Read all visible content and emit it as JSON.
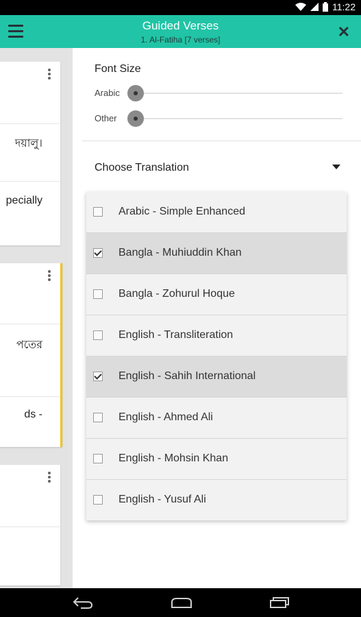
{
  "status_bar": {
    "time": "11:22",
    "icons": [
      "wifi-icon",
      "signal-icon",
      "battery-icon"
    ]
  },
  "app_bar": {
    "title": "Guided Verses",
    "subtitle": "1. Al-Fatiha [7 verses]",
    "accent": "#21c4a6"
  },
  "left_cards": [
    {
      "lines": [
        "দয়ালু।",
        "pecially"
      ]
    },
    {
      "lines": [
        "পতের",
        "ds -"
      ]
    },
    {
      "lines": []
    }
  ],
  "font_size": {
    "title": "Font Size",
    "arabic_label": "Arabic",
    "other_label": "Other"
  },
  "translation": {
    "label": "Choose Translation",
    "options": [
      {
        "label": "Arabic - Simple Enhanced",
        "checked": false
      },
      {
        "label": "Bangla - Muhiuddin Khan",
        "checked": true
      },
      {
        "label": "Bangla - Zohurul Hoque",
        "checked": false
      },
      {
        "label": "English - Transliteration",
        "checked": false
      },
      {
        "label": "English - Sahih International",
        "checked": true
      },
      {
        "label": "English - Ahmed Ali",
        "checked": false
      },
      {
        "label": "English - Mohsin Khan",
        "checked": false
      },
      {
        "label": "English - Yusuf Ali",
        "checked": false
      }
    ]
  },
  "nav_bar": {
    "icons": [
      "back-icon",
      "home-icon",
      "recents-icon"
    ]
  }
}
